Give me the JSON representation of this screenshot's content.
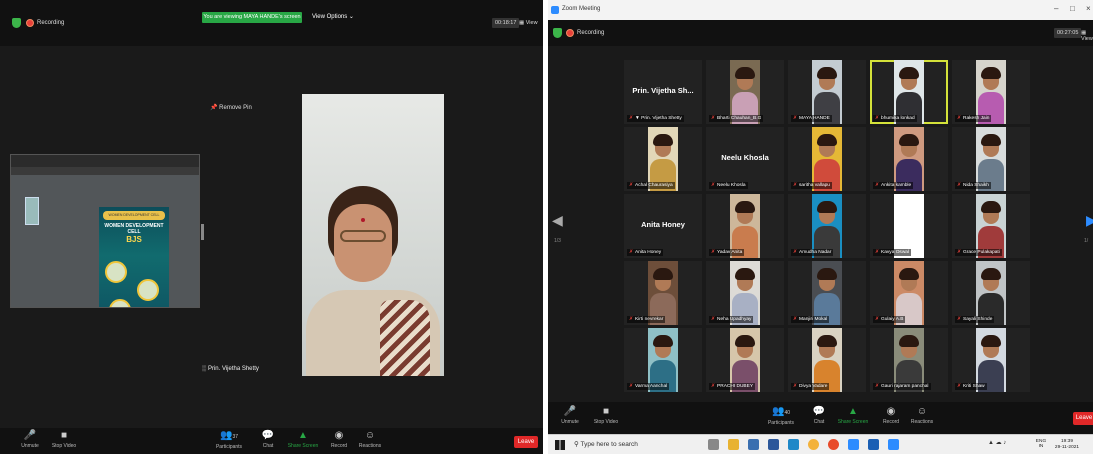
{
  "left": {
    "recording_label": "Recording",
    "viewing_banner": "You are viewing MAYA HANDE's screen",
    "view_options": "View Options ⌄",
    "timer": "00:18:17",
    "view_label": "View",
    "remove_pin": "Remove Pin",
    "active_speaker_name": "Prin. Vijetha Shetty",
    "toolbar": {
      "unmute": "Unmute",
      "stop_video": "Stop Video",
      "participants": "Participants",
      "participants_count": "37",
      "chat": "Chat",
      "chat_badge": "2",
      "share_screen": "Share Screen",
      "record": "Record",
      "reactions": "Reactions",
      "leave": "Leave"
    },
    "poster": {
      "header": "WOMEN DEVELOPMENT CELL",
      "title": "WOMEN DEVELOPMENT CELL",
      "subtitle": "BJS"
    }
  },
  "right": {
    "window_title": "Zoom Meeting",
    "recording_label": "Recording",
    "timer": "00:27:05",
    "view_label": "View",
    "page_left": "1/3",
    "page_right": "1/",
    "participants": [
      {
        "name": "Prin. Vijetha Shetty",
        "big_name": "Prin. Vijetha Sh...",
        "video": false,
        "pinned": true
      },
      {
        "name": "Bharti Chauhan_B.G",
        "video": true,
        "bg": "#7a6a52",
        "body": "#c9a0b5"
      },
      {
        "name": "MAYA HANDE",
        "video": true,
        "bg": "#c4ccd2",
        "body": "#3f3f44"
      },
      {
        "name": "bhumika lonkad",
        "video": true,
        "bg": "#dfe6e8",
        "body": "#2f2f33",
        "active": true
      },
      {
        "name": "Rakesh Jain",
        "video": true,
        "bg": "#d6d4cc",
        "body": "#b75cb0"
      },
      {
        "name": "Achal Chaurasiya",
        "video": true,
        "bg": "#e2d7b8",
        "body": "#c59b44"
      },
      {
        "name": "Neelu Khosla",
        "big_name": "Neelu Khosla",
        "video": false
      },
      {
        "name": "saritha vallapu",
        "video": true,
        "bg": "#e5b836",
        "body": "#d04b3b"
      },
      {
        "name": "Ankita kamble",
        "video": true,
        "bg": "#cf9a80",
        "body": "#3b2c5e"
      },
      {
        "name": "Nida Shaikh",
        "video": true,
        "bg": "#d8dcdc",
        "body": "#6b7c8c"
      },
      {
        "name": "Anita Honey",
        "big_name": "Anita Honey",
        "video": false
      },
      {
        "name": "Yadav Anita",
        "video": true,
        "bg": "#cdb79a",
        "body": "#c97c4e"
      },
      {
        "name": "Amudha Nadar",
        "video": true,
        "bg": "#1a8fc2",
        "body": "#3a3a3a"
      },
      {
        "name": "Kavya Oswal",
        "video": true,
        "bg": "#ffffff",
        "body": "#ffffff"
      },
      {
        "name": "Grace Pulakapati",
        "video": true,
        "bg": "#c9d3d4",
        "body": "#a03b3b"
      },
      {
        "name": "Kirti nevrekar",
        "video": true,
        "bg": "#6d4e3a",
        "body": "#8c6a5a"
      },
      {
        "name": "Neha Upadhyay",
        "video": true,
        "bg": "#dddbd6",
        "body": "#a8b0c4"
      },
      {
        "name": "Manjiri Mokal",
        "video": true,
        "bg": "#4a4d52",
        "body": "#5a7a9a"
      },
      {
        "name": "Gulaiy A.B",
        "video": true,
        "bg": "#cc8a66",
        "body": "#d8c8c8"
      },
      {
        "name": "Sayali Shinde",
        "video": true,
        "bg": "#c0c4c6",
        "body": "#2a2a2a"
      },
      {
        "name": "Varma Aanchal",
        "video": true,
        "bg": "#8fc0c6",
        "body": "#2d6f86"
      },
      {
        "name": "PRACHI DUBEY",
        "video": true,
        "bg": "#d6c6aa",
        "body": "#7a4f6a"
      },
      {
        "name": "Divya Vadare",
        "video": true,
        "bg": "#d9d2c2",
        "body": "#d8832d"
      },
      {
        "name": "Gauri rajaram panchal",
        "video": true,
        "bg": "#8a8c7a",
        "body": "#3a3a3a"
      },
      {
        "name": "Kriti Shaw",
        "video": true,
        "bg": "#d3d9e0",
        "body": "#3b3f52"
      }
    ],
    "toolbar": {
      "unmute": "Unmute",
      "stop_video": "Stop Video",
      "participants": "Participants",
      "participants_count": "40",
      "chat": "Chat",
      "chat_badge": "2",
      "share_screen": "Share Screen",
      "record": "Record",
      "reactions": "Reactions",
      "leave": "Leave"
    },
    "taskbar": {
      "search_placeholder": "Type here to search",
      "lang_top": "ENG",
      "lang_bottom": "IN",
      "time": "19:39",
      "date": "29-11-2021"
    }
  },
  "colors": {
    "accent_green": "#28a745",
    "leave_red": "#e02828",
    "active_speaker": "#d4e23a",
    "zoom_blue": "#2d8cff"
  }
}
